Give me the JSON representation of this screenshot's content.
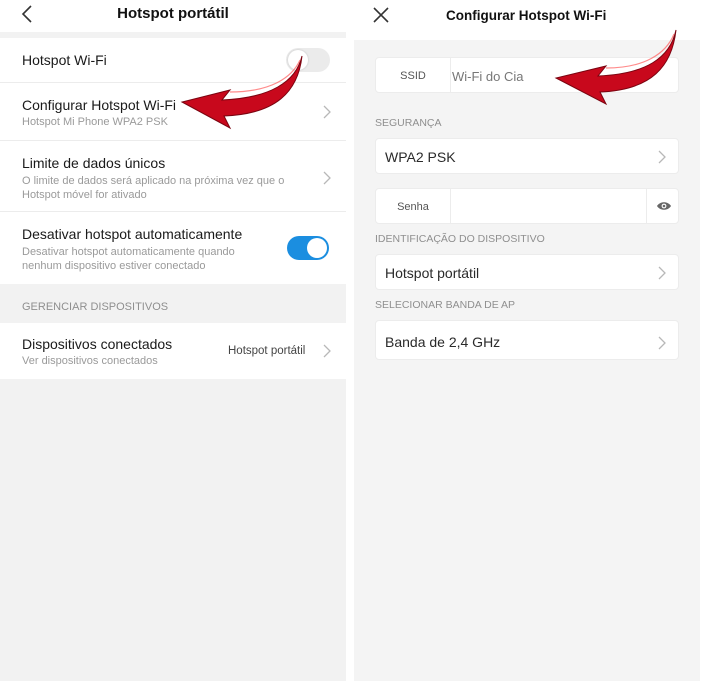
{
  "left": {
    "title": "Hotspot portátil",
    "rows": {
      "hotspot_wifi": {
        "label": "Hotspot Wi-Fi",
        "toggle_on": false
      },
      "configurar": {
        "label": "Configurar Hotspot Wi-Fi",
        "sub": "Hotspot Mi Phone WPA2 PSK"
      },
      "limite": {
        "label": "Limite de dados únicos",
        "sub": "O limite de dados será aplicado na próxima vez que o Hotspot móvel for ativado"
      },
      "desativar": {
        "label": "Desativar hotspot automaticamente",
        "sub": "Desativar hotspot automaticamente quando nenhum dispositivo estiver conectado",
        "toggle_on": true
      }
    },
    "section_gerenciar": "GERENCIAR DISPOSITIVOS",
    "dispositivos": {
      "label": "Dispositivos conectados",
      "sub": "Ver dispositivos conectados",
      "value": "Hotspot portátil"
    }
  },
  "right": {
    "title": "Configurar Hotspot Wi-Fi",
    "ssid": {
      "label": "SSID",
      "value": "Wi-Fi do Cia"
    },
    "section_seguranca": "SEGURANÇA",
    "seguranca_value": "WPA2 PSK",
    "senha": {
      "label": "Senha",
      "value": ""
    },
    "section_identificacao": "IDENTIFICAÇÃO DO DISPOSITIVO",
    "identificacao_value": "Hotspot portátil",
    "section_banda": "SELECIONAR BANDA DE AP",
    "banda_value": "Banda de 2,4 GHz"
  },
  "colors": {
    "accent_toggle": "#1b8ee0",
    "annotation_arrow": "#c8081c"
  },
  "icons": [
    "back-arrow-icon",
    "close-icon",
    "chevron-right-icon",
    "eye-icon",
    "annotation-arrow"
  ]
}
